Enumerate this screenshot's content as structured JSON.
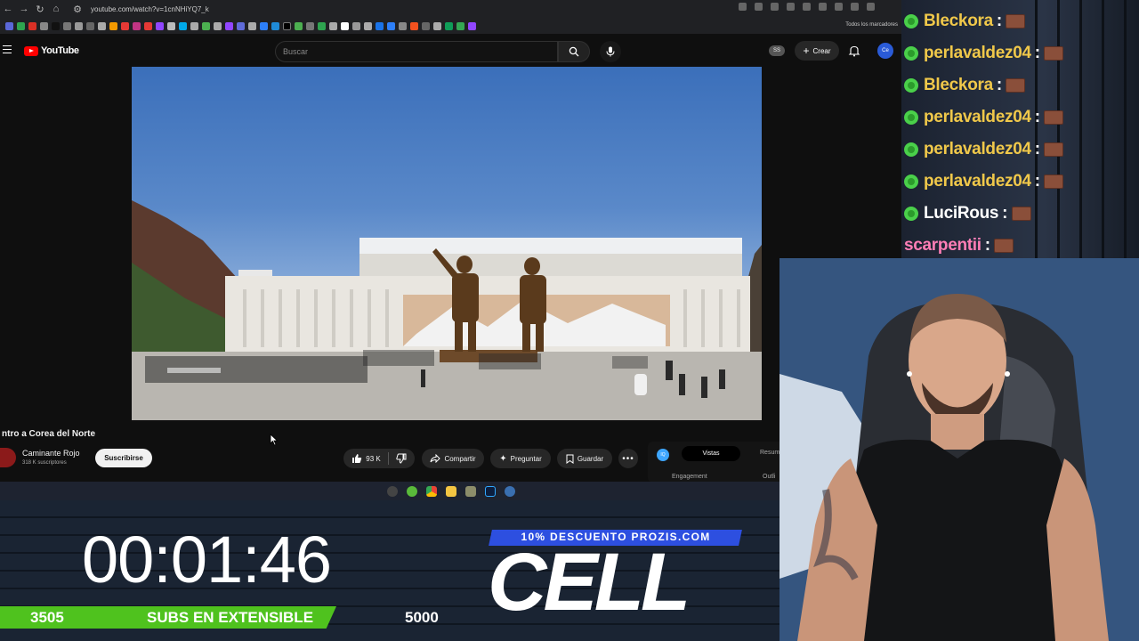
{
  "browser": {
    "url": "youtube.com/watch?v=1cnNHiYQ7_k",
    "bookmarks_all": "Todos los marcadores"
  },
  "youtube": {
    "logo_text": "YouTube",
    "search_placeholder": "Buscar",
    "ss_badge": "SS",
    "create_label": "Crear",
    "avatar_text": "Ce"
  },
  "video": {
    "title": "ntro a Corea del Norte",
    "channel_name": "Caminante Rojo",
    "channel_subs": "318 K suscriptores",
    "subscribe_label": "Suscribirse",
    "like_count": "93 K",
    "share_label": "Compartir",
    "ask_label": "Preguntar",
    "save_label": "Guardar"
  },
  "extension": {
    "logo": "IQ",
    "tab_active": "Vistas",
    "tab_other": "Resum",
    "engagement_label": "Engagement",
    "outlier_label": "Outli"
  },
  "chat": [
    {
      "user": "Bleckora",
      "color": "#f0c84a"
    },
    {
      "user": "perlavaldez04",
      "color": "#f0c84a"
    },
    {
      "user": "Bleckora",
      "color": "#f0c84a"
    },
    {
      "user": "perlavaldez04",
      "color": "#f0c84a"
    },
    {
      "user": "perlavaldez04",
      "color": "#f0c84a"
    },
    {
      "user": "perlavaldez04",
      "color": "#f0c84a"
    },
    {
      "user": "LuciRous",
      "color": "#ffffff"
    },
    {
      "user": "scarpentii",
      "color": "#ff7eb6"
    }
  ],
  "overlay": {
    "timer": "00:01:46",
    "subs_current": "3505",
    "subs_label": "SUBS EN EXTENSIBLE",
    "subs_goal": "5000",
    "subs_progress": 0.701,
    "promo_text": "10% DESCUENTO PROZIS.COM",
    "brand_text": "CELL"
  },
  "colors": {
    "accent_green": "#4fc21e",
    "promo_blue": "#2d4fe0",
    "youtube_red": "#ff0000"
  }
}
